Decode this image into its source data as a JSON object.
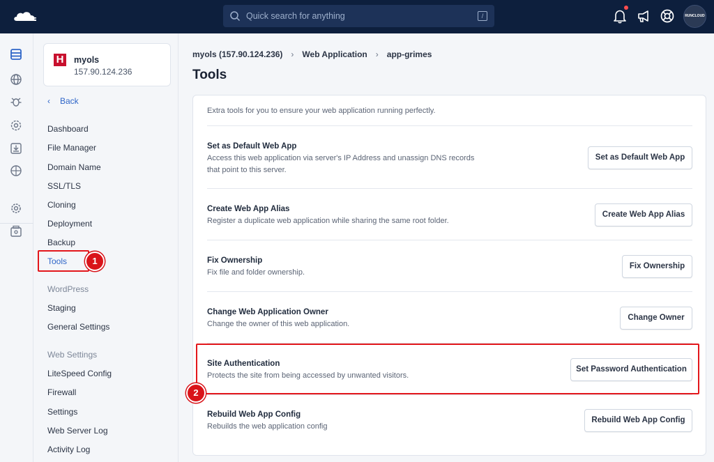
{
  "topbar": {
    "search_placeholder": "Quick search for anything",
    "kbd_hint": "/",
    "avatar_text": "RUNCLOUD",
    "icons": [
      "cloud-logo-icon",
      "search-icon",
      "bell-icon",
      "megaphone-icon",
      "support-icon"
    ]
  },
  "rail": {
    "icons": [
      "servers-icon",
      "globe-icon",
      "bug-icon",
      "settings-gear-icon",
      "backup-icon",
      "network-icon",
      "account-settings-icon",
      "billing-icon"
    ]
  },
  "sidebar": {
    "server": {
      "name": "myols",
      "ip": "157.90.124.236",
      "logo_letter": "H"
    },
    "back_label": "Back",
    "items": [
      {
        "label": "Dashboard"
      },
      {
        "label": "File Manager"
      },
      {
        "label": "Domain Name"
      },
      {
        "label": "SSL/TLS"
      },
      {
        "label": "Cloning"
      },
      {
        "label": "Deployment"
      },
      {
        "label": "Backup"
      },
      {
        "label": "Tools",
        "active": true
      }
    ],
    "wordpress_section": "WordPress",
    "wordpress_items": [
      {
        "label": "Staging"
      },
      {
        "label": "General Settings"
      }
    ],
    "web_settings_section": "Web Settings",
    "web_settings_items": [
      {
        "label": "LiteSpeed Config"
      },
      {
        "label": "Firewall"
      },
      {
        "label": "Settings"
      },
      {
        "label": "Web Server Log"
      },
      {
        "label": "Activity Log"
      }
    ]
  },
  "annotations": {
    "badge1": "1",
    "badge2": "2",
    "highlight_color": "#e3161b"
  },
  "breadcrumb": [
    "myols (157.90.124.236)",
    "Web Application",
    "app-grimes"
  ],
  "page_title": "Tools",
  "card": {
    "intro": "Extra tools for you to ensure your web application running perfectly.",
    "tools": [
      {
        "title": "Set as Default Web App",
        "desc": "Access this web application via server's IP Address and unassign DNS records that point to this server.",
        "button": "Set as Default Web App"
      },
      {
        "title": "Create Web App Alias",
        "desc": "Register a duplicate web application while sharing the same root folder.",
        "button": "Create Web App Alias"
      },
      {
        "title": "Fix Ownership",
        "desc": "Fix file and folder ownership.",
        "button": "Fix Ownership"
      },
      {
        "title": "Change Web Application Owner",
        "desc": "Change the owner of this web application.",
        "button": "Change Owner"
      },
      {
        "title": "Site Authentication",
        "desc": "Protects the site from being accessed by unwanted visitors.",
        "button": "Set Password Authentication"
      },
      {
        "title": "Rebuild Web App Config",
        "desc": "Rebuilds the web application config",
        "button": "Rebuild Web App Config"
      }
    ]
  }
}
